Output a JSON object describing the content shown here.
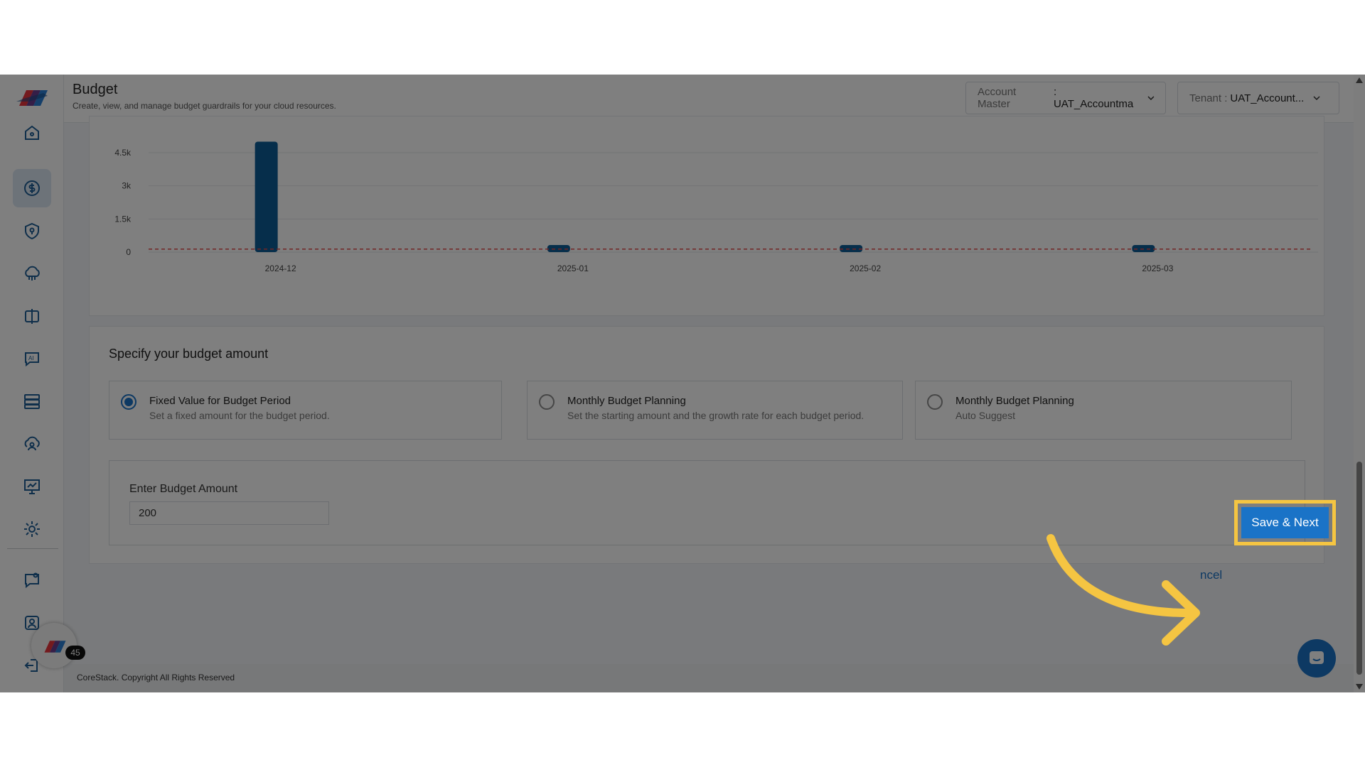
{
  "header": {
    "title": "Budget",
    "subtitle": "Create, view, and manage budget guardrails for your cloud resources.",
    "account_master_label": "Account Master",
    "account_master_value": ": UAT_Accountma",
    "tenant_label": "Tenant :",
    "tenant_value": "UAT_Account..."
  },
  "sidebar": {
    "icons": [
      "home-icon",
      "dollar-icon",
      "shield-icon",
      "cloud-icon",
      "compare-icon",
      "ai-chat-icon",
      "server-icon",
      "cloud-user-icon",
      "presentation-chart-icon",
      "gear-icon",
      "chat-question-icon",
      "user-card-icon",
      "logout-icon"
    ],
    "active": "dollar-icon"
  },
  "chart_data": {
    "type": "bar",
    "categories": [
      "2024-12",
      "2025-01",
      "2025-02",
      "2025-03"
    ],
    "values": [
      5000,
      200,
      150,
      200
    ],
    "threshold": 200,
    "yticks": [
      "0",
      "1.5k",
      "3k",
      "4.5k"
    ],
    "ylim": [
      0,
      4500
    ],
    "bar_color": "#0d5c96",
    "threshold_color": "#e24a4a"
  },
  "budget": {
    "title": "Specify your budget amount",
    "options": [
      {
        "title": "Fixed Value for Budget Period",
        "desc": "Set a fixed amount for the budget period.",
        "checked": true
      },
      {
        "title": "Monthly Budget Planning",
        "desc": "Set the starting amount and the growth rate for each budget period.",
        "checked": false
      },
      {
        "title": "Monthly Budget Planning",
        "desc": "Auto Suggest",
        "checked": false
      }
    ],
    "amount_label": "Enter Budget Amount",
    "amount_value": "200"
  },
  "actions": {
    "cancel_label": "ncel",
    "save_label": "Save & Next"
  },
  "footer": {
    "copyright": "CoreStack. Copyright All Rights Reserved"
  },
  "badge_count": "45",
  "colors": {
    "accent": "#1a73c7",
    "highlight": "#f5c542"
  }
}
